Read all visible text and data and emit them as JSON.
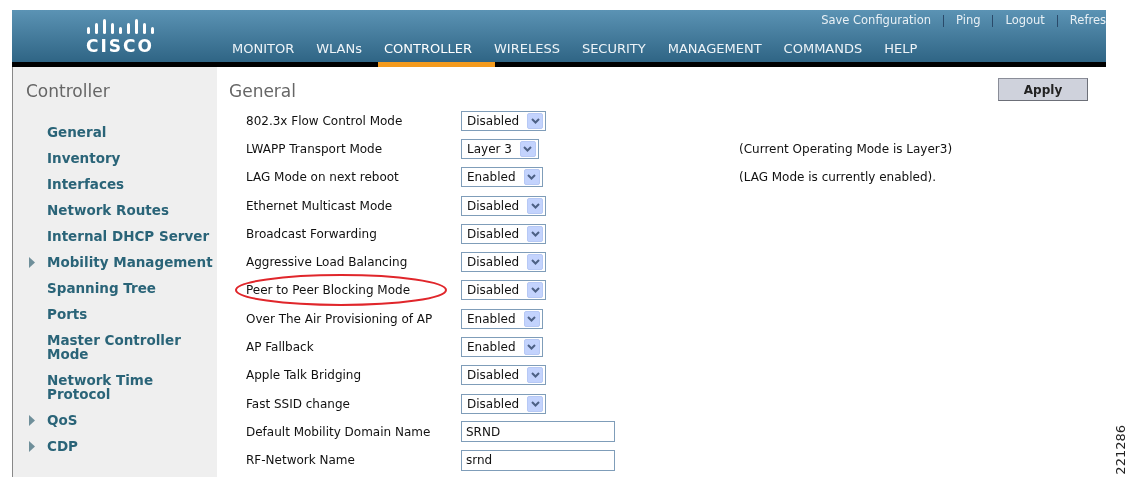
{
  "header": {
    "logo_text": "CISCO",
    "links": [
      "Save Configuration",
      "Ping",
      "Logout",
      "Refres"
    ],
    "nav": [
      {
        "label": "MONITOR",
        "selected": false
      },
      {
        "label": "WLANs",
        "selected": false
      },
      {
        "label": "CONTROLLER",
        "selected": true
      },
      {
        "label": "WIRELESS",
        "selected": false
      },
      {
        "label": "SECURITY",
        "selected": false
      },
      {
        "label": "MANAGEMENT",
        "selected": false
      },
      {
        "label": "COMMANDS",
        "selected": false
      },
      {
        "label": "HELP",
        "selected": false
      }
    ]
  },
  "sidebar": {
    "title": "Controller",
    "items": [
      {
        "label": "General",
        "expandable": false
      },
      {
        "label": "Inventory",
        "expandable": false
      },
      {
        "label": "Interfaces",
        "expandable": false
      },
      {
        "label": "Network Routes",
        "expandable": false
      },
      {
        "label": "Internal DHCP Server",
        "expandable": false
      },
      {
        "label": "Mobility Management",
        "expandable": true
      },
      {
        "label": "Spanning Tree",
        "expandable": false
      },
      {
        "label": "Ports",
        "expandable": false
      },
      {
        "label": "Master Controller Mode",
        "expandable": false
      },
      {
        "label": "Network Time Protocol",
        "expandable": false
      },
      {
        "label": "QoS",
        "expandable": true
      },
      {
        "label": "CDP",
        "expandable": true
      }
    ]
  },
  "main": {
    "title": "General",
    "apply_button": "Apply",
    "rows": [
      {
        "label": "802.3x Flow Control Mode",
        "kind": "select",
        "value": "Disabled",
        "highlighted": false
      },
      {
        "label": "LWAPP Transport Mode",
        "kind": "select",
        "value": "Layer 3",
        "note": "(Current Operating Mode is Layer3)",
        "highlighted": false
      },
      {
        "label": "LAG Mode on next reboot",
        "kind": "select",
        "value": "Enabled",
        "note": "(LAG Mode is currently enabled).",
        "highlighted": false
      },
      {
        "label": "Ethernet Multicast Mode",
        "kind": "select",
        "value": "Disabled",
        "highlighted": false
      },
      {
        "label": "Broadcast Forwarding",
        "kind": "select",
        "value": "Disabled",
        "highlighted": false
      },
      {
        "label": "Aggressive Load Balancing",
        "kind": "select",
        "value": "Disabled",
        "highlighted": false
      },
      {
        "label": "Peer to Peer Blocking Mode",
        "kind": "select",
        "value": "Disabled",
        "highlighted": true
      },
      {
        "label": "Over The Air Provisioning of AP",
        "kind": "select",
        "value": "Enabled",
        "highlighted": false
      },
      {
        "label": "AP Fallback",
        "kind": "select",
        "value": "Enabled",
        "highlighted": false
      },
      {
        "label": "Apple Talk Bridging",
        "kind": "select",
        "value": "Disabled",
        "highlighted": false
      },
      {
        "label": "Fast SSID change",
        "kind": "select",
        "value": "Disabled",
        "highlighted": false
      },
      {
        "label": "Default Mobility Domain Name",
        "kind": "text",
        "value": "SRND",
        "highlighted": false
      },
      {
        "label": "RF-Network Name",
        "kind": "text",
        "value": "srnd",
        "highlighted": false
      }
    ]
  },
  "figure_number": "221286"
}
